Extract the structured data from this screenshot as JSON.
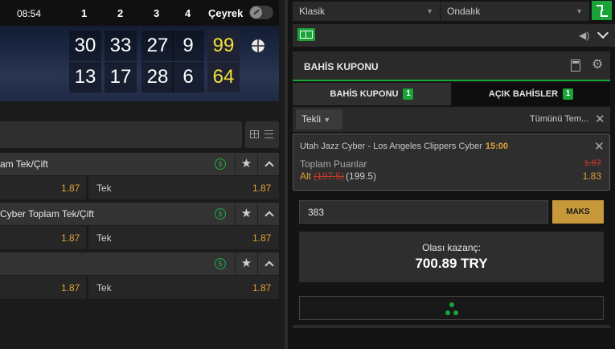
{
  "scoreboard": {
    "clock": "08:54",
    "quarters": [
      "1",
      "2",
      "3",
      "4"
    ],
    "quarter_label": "Çeyrek",
    "home_scores": [
      "30",
      "33",
      "27",
      "9"
    ],
    "home_total": "99",
    "away_scores": [
      "13",
      "17",
      "28",
      "6"
    ],
    "away_total": "64"
  },
  "markets": [
    {
      "title": "am Tek/Çift",
      "odd_a": "1.87",
      "label_b": "Tek",
      "odd_b": "1.87"
    },
    {
      "title": "Cyber Toplam Tek/Çift",
      "odd_a": "1.87",
      "label_b": "Tek",
      "odd_b": "1.87"
    },
    {
      "title": "",
      "odd_a": "1.87",
      "label_b": "Tek",
      "odd_b": "1.87"
    }
  ],
  "market_icons": {
    "dollar": "$",
    "star": "★"
  },
  "top_selects": {
    "view": "Klasik",
    "odds_format": "Ondalık"
  },
  "coupon": {
    "title": "BAHİS KUPONU",
    "tab_coupon": "BAHİS KUPONU",
    "tab_coupon_count": "1",
    "tab_open": "AÇIK BAHİSLER",
    "tab_open_count": "1",
    "mode": "Tekli",
    "remove_all": "Tümünü Tem...",
    "bet": {
      "match": "Utah Jazz Cyber - Los Angeles Clippers Cyber",
      "time": "15:00",
      "market": "Toplam Puanlar",
      "old_odd": "1.67",
      "selection": "Alt",
      "old_line": "(197.5)",
      "new_line": "(199.5)",
      "new_odd": "1.83"
    },
    "stake": "383",
    "max_label": "MAKS",
    "win_label": "Olası kazanç:",
    "win_value": "700.89 TRY"
  },
  "colors": {
    "accent": "#1aa336",
    "odds": "#e0a23a",
    "total": "#f2e03b",
    "max": "#c8993a"
  }
}
